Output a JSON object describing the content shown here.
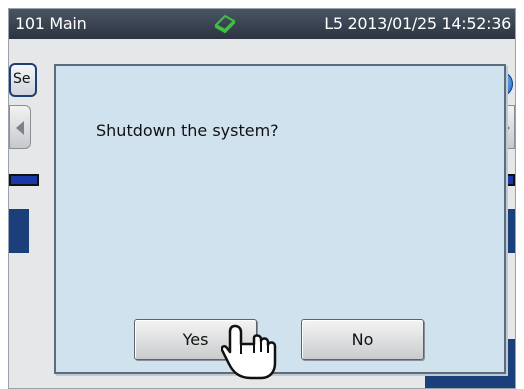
{
  "status_bar": {
    "location": "101 Main",
    "status": "L5 2013/01/25 14:52:36",
    "icon": "device-icon"
  },
  "background": {
    "tab_label": "Se"
  },
  "dialog": {
    "message": "Shutdown the system?",
    "yes_label": "Yes",
    "no_label": "No"
  },
  "icons": {
    "pointer": "hand-pointer-icon",
    "nav_left": "chevron-left-icon",
    "nav_right": "chevron-right-icon"
  },
  "colors": {
    "status_bar": "#2c3440",
    "dialog_bg": "#d1e2ef",
    "accent_blue": "#1b3f7a",
    "device_icon": "#3ec13e"
  }
}
